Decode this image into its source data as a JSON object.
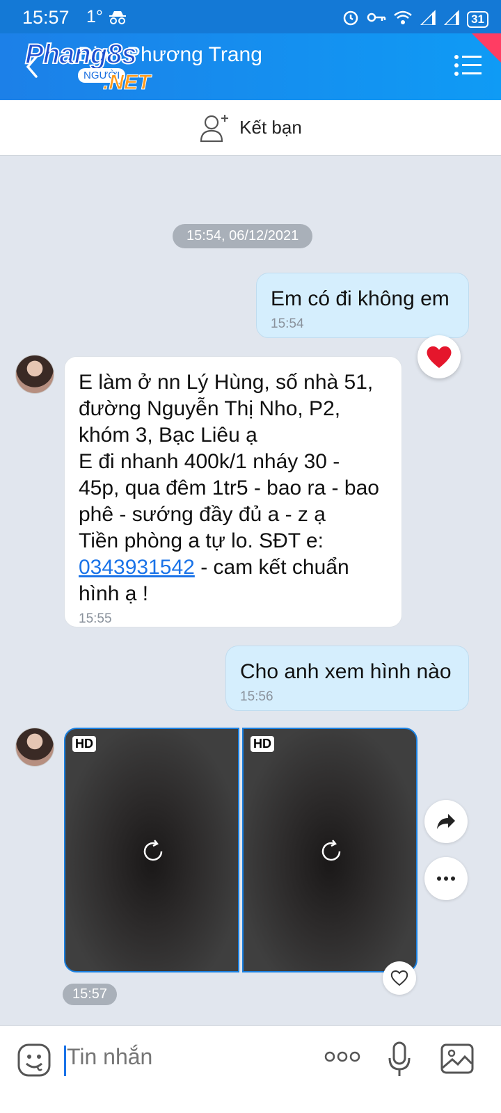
{
  "status": {
    "time": "15:57",
    "temp": "1°",
    "battery": "31"
  },
  "header": {
    "contact_name": "Đinh Phương Trang",
    "watermark_main": "Phang8s",
    "watermark_sub": "NGƯỜI",
    "watermark_net": ".NET"
  },
  "add_friend": {
    "label": "Kết bạn"
  },
  "chat": {
    "date_chip": "15:54, 06/12/2021",
    "messages": [
      {
        "text": "Em có đi không em",
        "time": "15:54"
      },
      {
        "lines": [
          "E làm ở nn Lý Hùng, số nhà 51,",
          "đường Nguyễn Thị Nho, P2,",
          "khóm 3, Bạc Liêu ạ",
          "E đi nhanh 400k/1 nháy 30 -",
          "45p, qua đêm 1tr5 - bao ra - bao",
          "phê - sướng đầy đủ a - z ạ",
          "Tiền phòng a tự lo. SĐT e:"
        ],
        "phone": "0343931542",
        "after_phone": " - cam kết chuẩn",
        "last_line": "hình ạ !",
        "time": "15:55"
      },
      {
        "text": "Cho anh xem hình nào",
        "time": "15:56"
      }
    ],
    "photos": {
      "hd_label": "HD",
      "time": "15:57"
    }
  },
  "input": {
    "placeholder": "Tin nhắn"
  }
}
